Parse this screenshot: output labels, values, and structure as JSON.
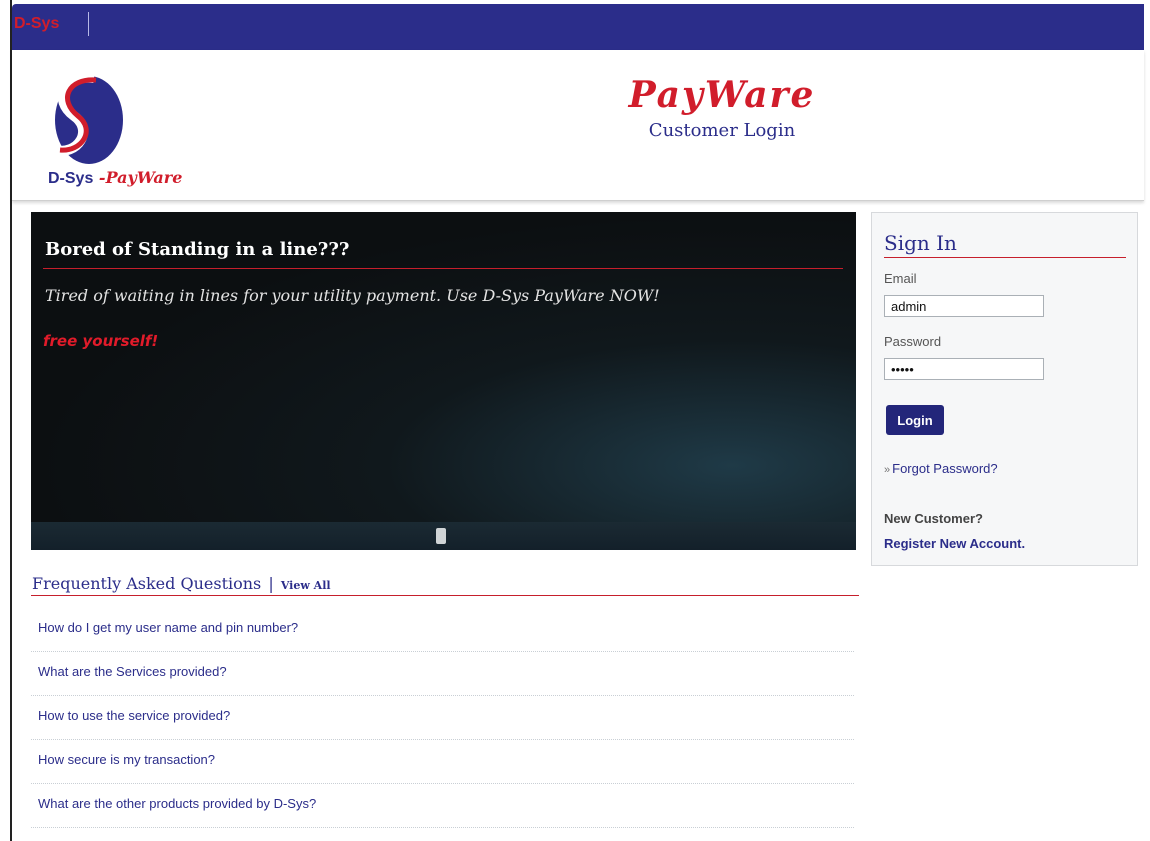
{
  "topbar": {
    "brand": "D-Sys"
  },
  "header": {
    "logo_text_main": "D-Sys",
    "logo_text_dash": " -",
    "logo_text_product": "PayWare",
    "title": "PayWare",
    "subtitle": "Customer Login"
  },
  "banner": {
    "title": "Bored of Standing in a line???",
    "text": "Tired of waiting in lines for your utility payment. Use D-Sys PayWare NOW!",
    "tagline": "free yourself!"
  },
  "signin": {
    "title": "Sign In",
    "email_label": "Email",
    "email_value": "admin",
    "password_label": "Password",
    "password_value": "•••••",
    "login_label": "Login",
    "forgot_label": "Forgot Password?",
    "new_customer_label": "New Customer?",
    "register_label": "Register New Account."
  },
  "faq": {
    "title": "Frequently Asked Questions",
    "separator": "|",
    "view_all": "View All",
    "items": [
      {
        "label": "How do I get my user name and pin number?"
      },
      {
        "label": "What are the Services provided?"
      },
      {
        "label": "How to use the service provided?"
      },
      {
        "label": "How secure is my transaction?"
      },
      {
        "label": "What are the other products provided by D-Sys?"
      }
    ]
  },
  "colors": {
    "navy": "#2b2d8a",
    "brand_red": "#d11d2b"
  }
}
